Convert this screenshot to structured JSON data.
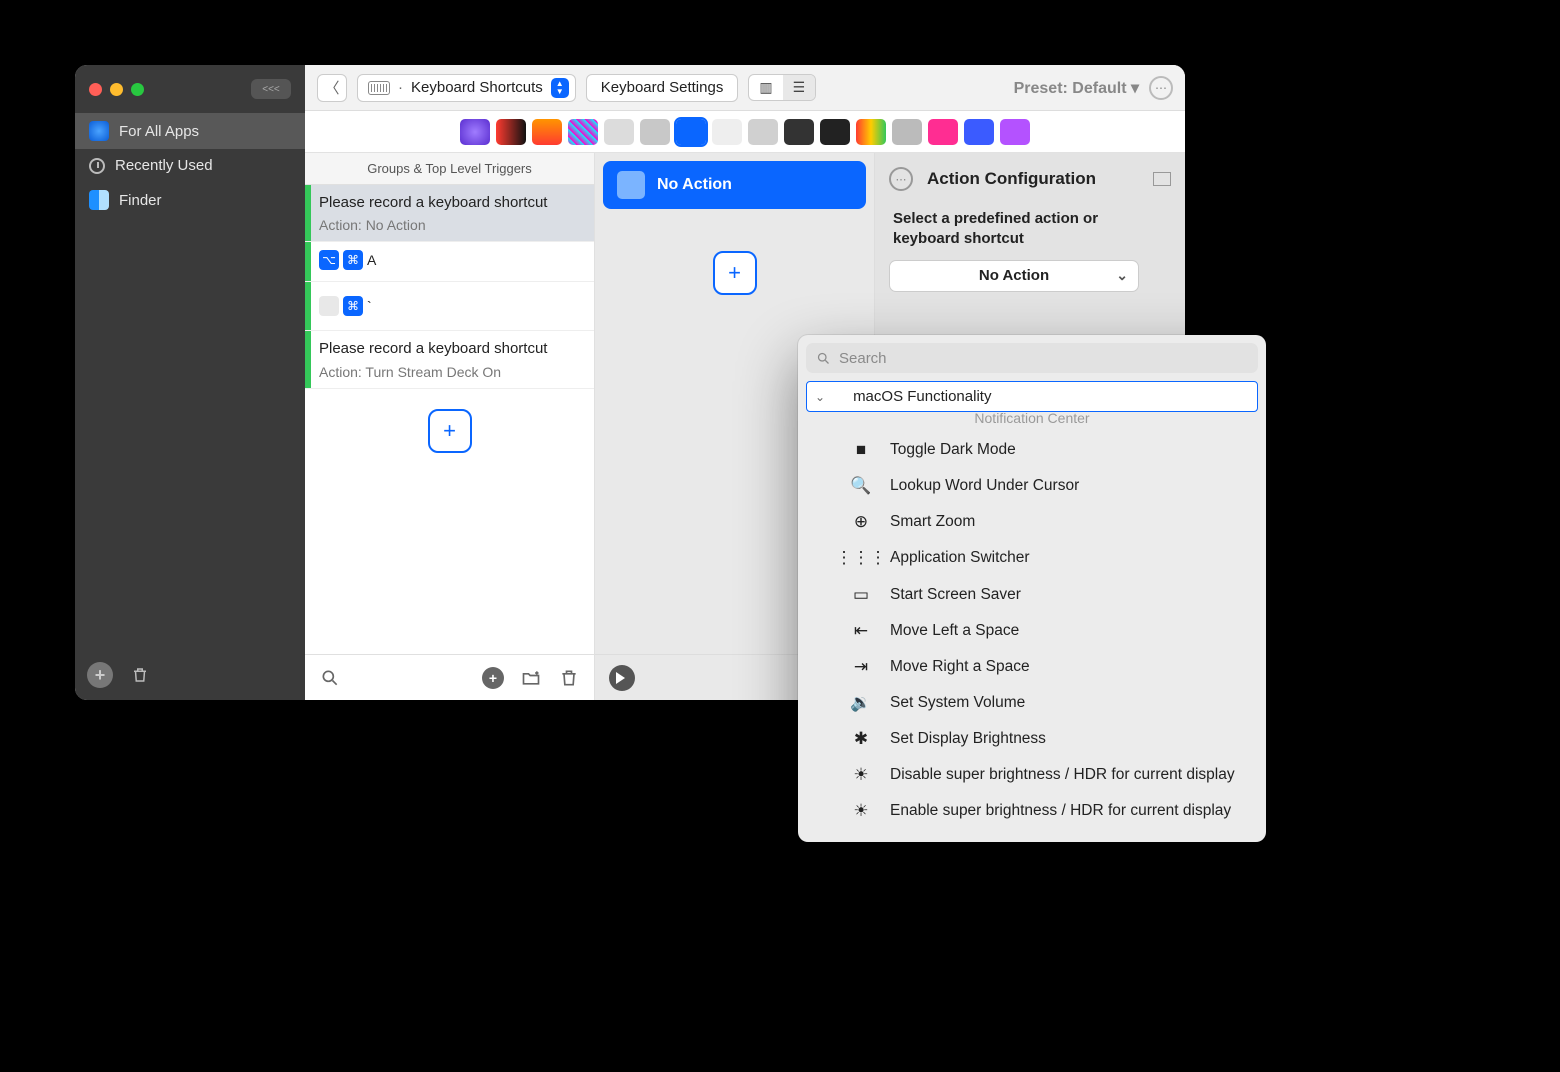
{
  "sidebar": {
    "back_pill": "<<<",
    "items": [
      {
        "label": "For All Apps",
        "icon": "globe",
        "selected": true
      },
      {
        "label": "Recently Used",
        "icon": "clock",
        "selected": false
      },
      {
        "label": "Finder",
        "icon": "finder",
        "selected": false
      }
    ]
  },
  "toolbar": {
    "dropdown_label": "Keyboard Shortcuts",
    "settings_label": "Keyboard Settings",
    "preset_label": "Preset: Default ▾"
  },
  "triggers": {
    "header": "Groups & Top Level Triggers",
    "items": [
      {
        "title": "Please record a keyboard shortcut",
        "sub": "Action: No Action",
        "selected": true,
        "kind": "text"
      },
      {
        "title": "A",
        "kind": "keys_alt_cmd"
      },
      {
        "title": "`",
        "kind": "keys_cmd"
      },
      {
        "title": "Please record a keyboard shortcut",
        "sub": "Action: Turn Stream Deck On",
        "kind": "text"
      }
    ]
  },
  "action_bar": {
    "label": "No Action"
  },
  "config": {
    "title": "Action Configuration",
    "prompt": "Select a predefined action or keyboard shortcut",
    "select_value": "No Action"
  },
  "popover": {
    "search_placeholder": "Search",
    "group_label": "macOS Functionality",
    "truncated_above": "Notification Center",
    "options": [
      {
        "icon": "■",
        "label": "Toggle Dark Mode"
      },
      {
        "icon": "🔍",
        "label": "Lookup Word Under Cursor"
      },
      {
        "icon": "⊕",
        "label": "Smart Zoom"
      },
      {
        "icon": "⋮⋮⋮",
        "label": "Application Switcher"
      },
      {
        "icon": "▭",
        "label": "Start Screen Saver"
      },
      {
        "icon": "⇤",
        "label": "Move Left a Space"
      },
      {
        "icon": "⇥",
        "label": "Move Right a Space"
      },
      {
        "icon": "🔉",
        "label": "Set System Volume"
      },
      {
        "icon": "✱",
        "label": "Set Display Brightness"
      },
      {
        "icon": "☀",
        "label": "Disable super brightness / HDR for current display"
      },
      {
        "icon": "☀",
        "label": "Enable super brightness / HDR for current display"
      }
    ]
  }
}
